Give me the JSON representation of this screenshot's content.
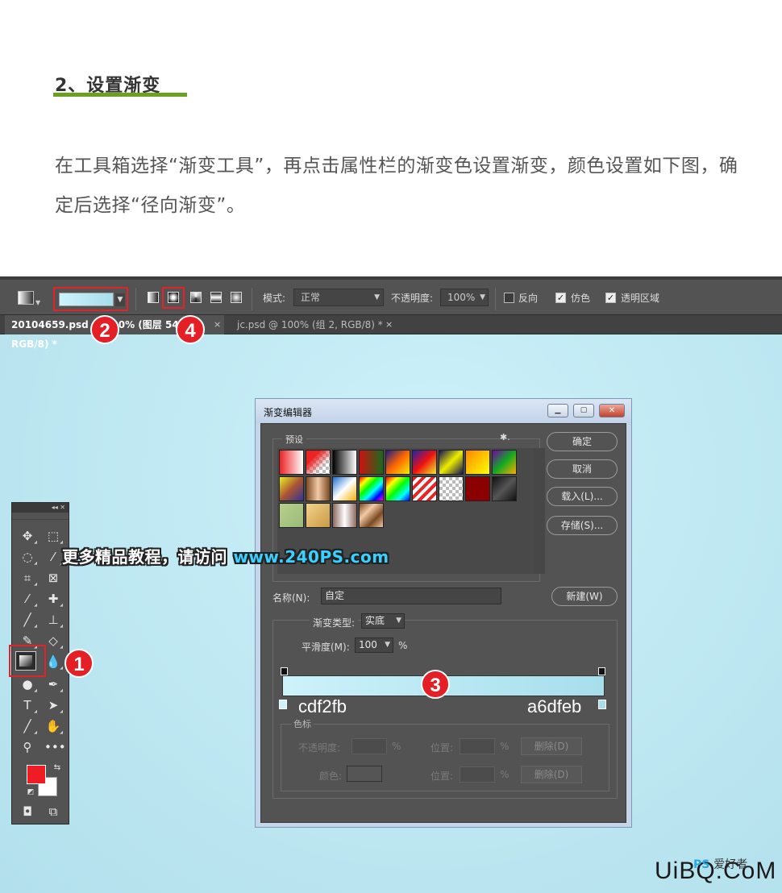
{
  "article": {
    "title": "2、设置渐变",
    "desc": "在工具箱选择“渐变工具”，再点击属性栏的渐变色设置渐变，颜色设置如下图，确定后选择“径向渐变”。"
  },
  "options_bar": {
    "mode_label": "模式:",
    "mode_value": "正常",
    "opacity_label": "不透明度:",
    "opacity_value": "100%",
    "reverse_label": "反向",
    "dither_label": "仿色",
    "transparency_label": "透明区域",
    "dither_checked": true,
    "transparency_checked": true,
    "reverse_checked": false
  },
  "tabs": [
    {
      "label": "20104659.psd @ 100% (图层 54, RGB/8) *",
      "close": "×"
    },
    {
      "label": "jc.psd @ 100% (组 2, RGB/8) *",
      "close": "×"
    }
  ],
  "badges": {
    "b1": "1",
    "b2": "2",
    "b3": "3",
    "b4": "4"
  },
  "watermark": {
    "text": "更多精品教程，请访问 ",
    "url": "www.240PS.com"
  },
  "dialog": {
    "title": "渐变编辑器",
    "presets_label": "预设",
    "gear": "✱.",
    "buttons": {
      "ok": "确定",
      "cancel": "取消",
      "load": "载入(L)...",
      "save": "存储(S)...",
      "new": "新建(W)"
    },
    "name_label": "名称(N):",
    "name_value": "自定",
    "type_label": "渐变类型:",
    "type_value": "实底",
    "smooth_label": "平滑度(M):",
    "smooth_value": "100",
    "smooth_unit": "%",
    "stops_group_label": "色标",
    "opacity_label": "不透明度:",
    "position_label": "位置:",
    "percent": "%",
    "delete_label": "删除(D)",
    "color_label": "颜色:",
    "stop_left_hex": "cdf2fb",
    "stop_right_hex": "a6dfeb",
    "colors": {
      "left": "#cdf2fb",
      "right": "#a6dfeb"
    }
  },
  "corner": {
    "logo": "UiBQ.CoM",
    "ps_mark": "PS",
    "site": "爱好者"
  },
  "colors": {
    "accent_green": "#6aa121",
    "highlight_red": "#e0242a",
    "fg": "#ee1c25",
    "bg": "#ffffff"
  }
}
